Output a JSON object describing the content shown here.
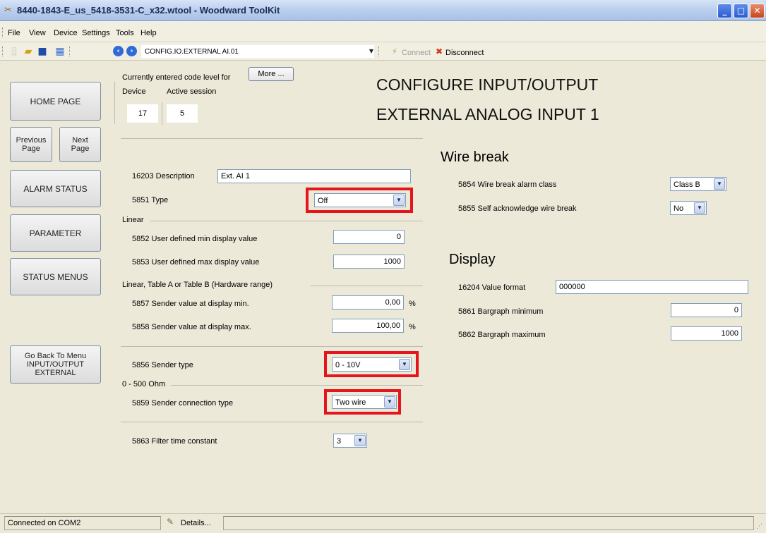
{
  "window": {
    "title": "8440-1843-E_us_5418-3531-C_x32.wtool - Woodward ToolKit"
  },
  "menu": [
    "File",
    "View",
    "Device",
    "Settings",
    "Tools",
    "Help"
  ],
  "toolbar": {
    "address": "CONFIG.IO.EXTERNAL AI.01",
    "connect_label": "Connect",
    "disconnect_label": "Disconnect"
  },
  "nav": {
    "home": "HOME PAGE",
    "previous": "Previous Page",
    "next": "Next Page",
    "alarm_status": "ALARM STATUS",
    "parameter": "PARAMETER",
    "status_menus": "STATUS MENUS",
    "go_back": "Go Back To Menu INPUT/OUTPUT EXTERNAL"
  },
  "code_level": {
    "caption": "Currently entered code level for",
    "device_label": "Device",
    "session_label": "Active session",
    "device_value": "17",
    "session_value": "5",
    "more_button": "More ..."
  },
  "page_heading": {
    "line1": "CONFIGURE INPUT/OUTPUT",
    "line2": "EXTERNAL ANALOG INPUT 1"
  },
  "left_form": {
    "description_label": "16203 Description",
    "description_value": "Ext. AI 1",
    "type_label": "5851 Type",
    "type_value": "Off",
    "linear_group": "Linear",
    "min_display_label": "5852 User defined min display value",
    "min_display_value": "0",
    "max_display_label": "5853 User defined max display value",
    "max_display_value": "1000",
    "hw_group": "Linear, Table A or Table B (Hardware range)",
    "sender_min_label": "5857 Sender value at display min.",
    "sender_min_value": "0,00",
    "sender_max_label": "5858 Sender value at display max.",
    "sender_max_value": "100,00",
    "percent_unit": "%",
    "sender_type_label": "5856 Sender type",
    "sender_type_value": "0 - 10V",
    "ohm_group": "0 - 500 Ohm",
    "connection_label": "5859 Sender connection type",
    "connection_value": "Two wire",
    "filter_label": "5863 Filter time constant",
    "filter_value": "3"
  },
  "wire_break": {
    "heading": "Wire break",
    "alarm_class_label": "5854 Wire break alarm class",
    "alarm_class_value": "Class B",
    "self_ack_label": "5855 Self acknowledge wire break",
    "self_ack_value": "No"
  },
  "display": {
    "heading": "Display",
    "format_label": "16204 Value format",
    "format_value": "000000",
    "bar_min_label": "5861 Bargraph minimum",
    "bar_min_value": "0",
    "bar_max_label": "5862 Bargraph maximum",
    "bar_max_value": "1000"
  },
  "statusbar": {
    "connection": "Connected on COM2",
    "details": "Details..."
  }
}
